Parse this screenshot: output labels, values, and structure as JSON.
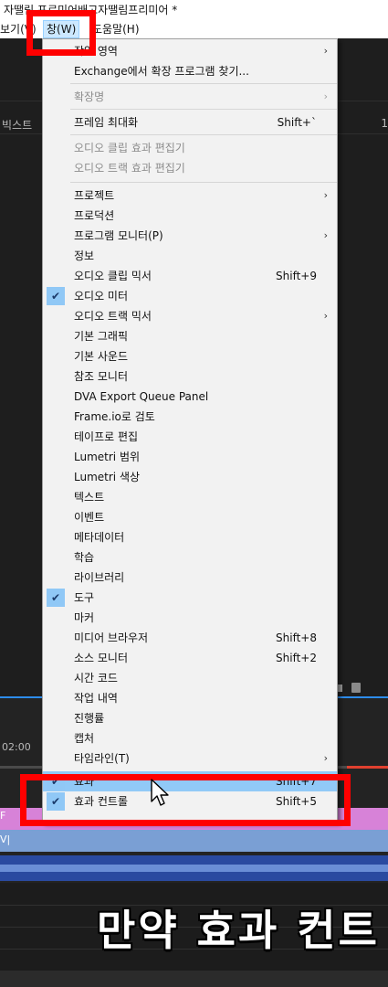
{
  "titlebar": {
    "title": "자땔림 프로미어배고자땔림프리미어 *"
  },
  "menubar": {
    "view": "보기(V)",
    "window": "창(W)",
    "help": "도움말(H)"
  },
  "panels": {
    "tab_left": "빅스트",
    "tab_right": "1",
    "timecode": "02:00"
  },
  "timeline": {
    "pink_clip_label": "F",
    "blue_clip_label": "V|",
    "subtitle": "만약 효과 컨트"
  },
  "window_menu": {
    "items": [
      {
        "label": "작업 영역",
        "arrow": "›"
      },
      {
        "label": "Exchange에서 확장 프로그램 찾기..."
      },
      {
        "label": "확장명",
        "arrow": "›",
        "disabled": true
      },
      {
        "label": "프레임 최대화",
        "shortcut": "Shift+`"
      },
      {
        "label": "오디오 클립 효과 편집기",
        "disabled": true
      },
      {
        "label": "오디오 트랙 효과 편집기",
        "disabled": true
      },
      {
        "label": "프로젝트",
        "arrow": "›"
      },
      {
        "label": "프로덕션"
      },
      {
        "label": "프로그램 모니터(P)",
        "arrow": "›"
      },
      {
        "label": "정보"
      },
      {
        "label": "오디오 클립 믹서",
        "shortcut": "Shift+9"
      },
      {
        "label": "오디오 미터",
        "checked": true
      },
      {
        "label": "오디오 트랙 믹서",
        "arrow": "›"
      },
      {
        "label": "기본 그래픽"
      },
      {
        "label": "기본 사운드"
      },
      {
        "label": "참조 모니터"
      },
      {
        "label": "DVA Export Queue Panel"
      },
      {
        "label": "Frame.io로 검토"
      },
      {
        "label": "테이프로 편집"
      },
      {
        "label": "Lumetri 범위"
      },
      {
        "label": "Lumetri 색상"
      },
      {
        "label": "텍스트"
      },
      {
        "label": "이벤트"
      },
      {
        "label": "메타데이터"
      },
      {
        "label": "학습"
      },
      {
        "label": "라이브러리"
      },
      {
        "label": "도구",
        "checked": true
      },
      {
        "label": "마커"
      },
      {
        "label": "미디어 브라우저",
        "shortcut": "Shift+8"
      },
      {
        "label": "소스 모니터",
        "shortcut": "Shift+2"
      },
      {
        "label": "시간 코드"
      },
      {
        "label": "작업 내역"
      },
      {
        "label": "진행률"
      },
      {
        "label": "캡처"
      },
      {
        "label": "타임라인(T)",
        "arrow": "›"
      },
      {
        "label": "효과",
        "shortcut": "Shift+7",
        "checked": true,
        "highlighted": true
      },
      {
        "label": "효과 컨트롤",
        "shortcut": "Shift+5",
        "checked": true
      }
    ],
    "check_mark": "✔"
  },
  "colors": {
    "highlight": "#91c9f7",
    "annotation_red": "#ff0000",
    "panel_blue_line": "#2d8ceb"
  }
}
